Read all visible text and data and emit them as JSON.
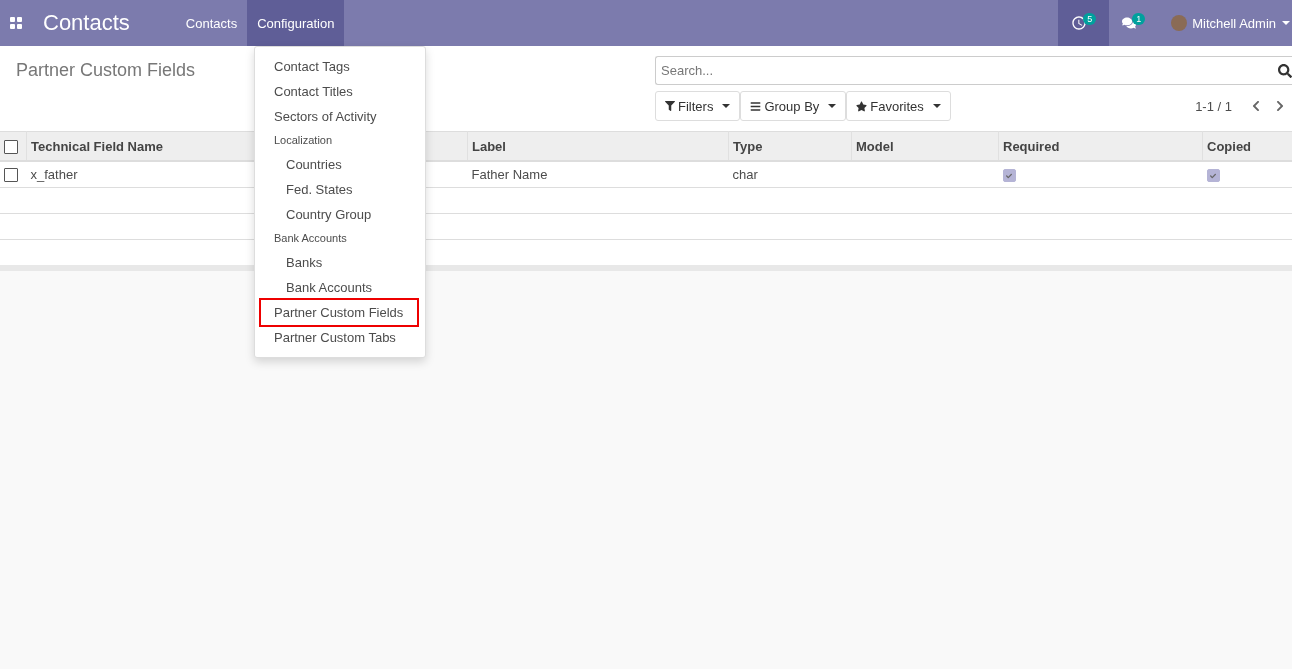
{
  "navbar": {
    "app_title": "Contacts",
    "menus": [
      {
        "label": "Contacts",
        "selected": false
      },
      {
        "label": "Configuration",
        "selected": true
      }
    ],
    "activity_count": "5",
    "message_count": "1",
    "user": "Mitchell Admin"
  },
  "dropdown": [
    {
      "kind": "item",
      "label": "Contact Tags",
      "highlighted": false
    },
    {
      "kind": "item",
      "label": "Contact Titles",
      "highlighted": false
    },
    {
      "kind": "item",
      "label": "Sectors of Activity",
      "highlighted": false
    },
    {
      "kind": "header",
      "label": "Localization",
      "highlighted": false
    },
    {
      "kind": "subitem",
      "label": "Countries",
      "highlighted": false
    },
    {
      "kind": "subitem",
      "label": "Fed. States",
      "highlighted": false
    },
    {
      "kind": "subitem",
      "label": "Country Group",
      "highlighted": false
    },
    {
      "kind": "header",
      "label": "Bank Accounts",
      "highlighted": false
    },
    {
      "kind": "subitem",
      "label": "Banks",
      "highlighted": false
    },
    {
      "kind": "subitem",
      "label": "Bank Accounts",
      "highlighted": false
    },
    {
      "kind": "item",
      "label": "Partner Custom Fields",
      "highlighted": true
    },
    {
      "kind": "item",
      "label": "Partner Custom Tabs",
      "highlighted": false
    }
  ],
  "page_title": "Partner Custom Fields",
  "search": {
    "placeholder": "Search..."
  },
  "filter_buttons": [
    {
      "kind": "filter",
      "label": "Filters"
    },
    {
      "kind": "group",
      "label": "Group By"
    },
    {
      "kind": "star",
      "label": "Favorites"
    }
  ],
  "pager": "1-1 / 1",
  "table": {
    "select_all_checked": false,
    "columns": [
      "Technical Field Name",
      null,
      "Label",
      "Type",
      "Model",
      "Required",
      "Copied"
    ],
    "rows": [
      {
        "checked": false,
        "technical_field_name": "x_father",
        "label": "Father Name",
        "type": "char",
        "model": "",
        "required": true,
        "copied": true
      }
    ]
  }
}
